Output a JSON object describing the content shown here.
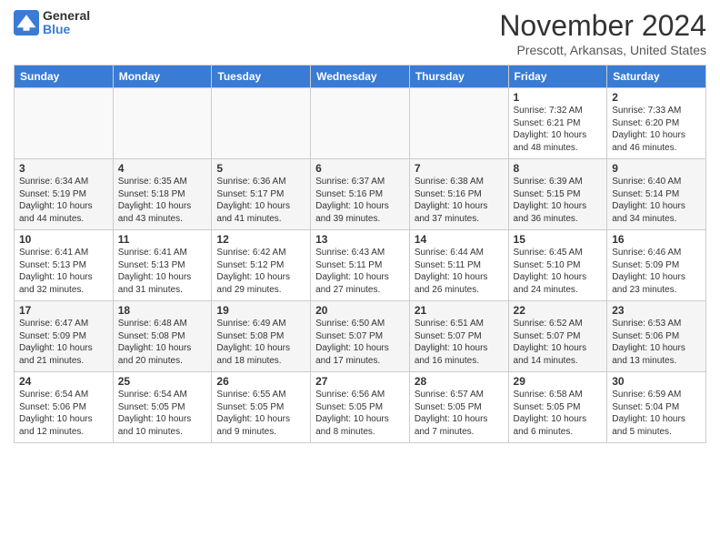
{
  "logo": {
    "general": "General",
    "blue": "Blue"
  },
  "header": {
    "month": "November 2024",
    "location": "Prescott, Arkansas, United States"
  },
  "weekdays": [
    "Sunday",
    "Monday",
    "Tuesday",
    "Wednesday",
    "Thursday",
    "Friday",
    "Saturday"
  ],
  "weeks": [
    [
      {
        "day": "",
        "info": ""
      },
      {
        "day": "",
        "info": ""
      },
      {
        "day": "",
        "info": ""
      },
      {
        "day": "",
        "info": ""
      },
      {
        "day": "",
        "info": ""
      },
      {
        "day": "1",
        "info": "Sunrise: 7:32 AM\nSunset: 6:21 PM\nDaylight: 10 hours\nand 48 minutes."
      },
      {
        "day": "2",
        "info": "Sunrise: 7:33 AM\nSunset: 6:20 PM\nDaylight: 10 hours\nand 46 minutes."
      }
    ],
    [
      {
        "day": "3",
        "info": "Sunrise: 6:34 AM\nSunset: 5:19 PM\nDaylight: 10 hours\nand 44 minutes."
      },
      {
        "day": "4",
        "info": "Sunrise: 6:35 AM\nSunset: 5:18 PM\nDaylight: 10 hours\nand 43 minutes."
      },
      {
        "day": "5",
        "info": "Sunrise: 6:36 AM\nSunset: 5:17 PM\nDaylight: 10 hours\nand 41 minutes."
      },
      {
        "day": "6",
        "info": "Sunrise: 6:37 AM\nSunset: 5:16 PM\nDaylight: 10 hours\nand 39 minutes."
      },
      {
        "day": "7",
        "info": "Sunrise: 6:38 AM\nSunset: 5:16 PM\nDaylight: 10 hours\nand 37 minutes."
      },
      {
        "day": "8",
        "info": "Sunrise: 6:39 AM\nSunset: 5:15 PM\nDaylight: 10 hours\nand 36 minutes."
      },
      {
        "day": "9",
        "info": "Sunrise: 6:40 AM\nSunset: 5:14 PM\nDaylight: 10 hours\nand 34 minutes."
      }
    ],
    [
      {
        "day": "10",
        "info": "Sunrise: 6:41 AM\nSunset: 5:13 PM\nDaylight: 10 hours\nand 32 minutes."
      },
      {
        "day": "11",
        "info": "Sunrise: 6:41 AM\nSunset: 5:13 PM\nDaylight: 10 hours\nand 31 minutes."
      },
      {
        "day": "12",
        "info": "Sunrise: 6:42 AM\nSunset: 5:12 PM\nDaylight: 10 hours\nand 29 minutes."
      },
      {
        "day": "13",
        "info": "Sunrise: 6:43 AM\nSunset: 5:11 PM\nDaylight: 10 hours\nand 27 minutes."
      },
      {
        "day": "14",
        "info": "Sunrise: 6:44 AM\nSunset: 5:11 PM\nDaylight: 10 hours\nand 26 minutes."
      },
      {
        "day": "15",
        "info": "Sunrise: 6:45 AM\nSunset: 5:10 PM\nDaylight: 10 hours\nand 24 minutes."
      },
      {
        "day": "16",
        "info": "Sunrise: 6:46 AM\nSunset: 5:09 PM\nDaylight: 10 hours\nand 23 minutes."
      }
    ],
    [
      {
        "day": "17",
        "info": "Sunrise: 6:47 AM\nSunset: 5:09 PM\nDaylight: 10 hours\nand 21 minutes."
      },
      {
        "day": "18",
        "info": "Sunrise: 6:48 AM\nSunset: 5:08 PM\nDaylight: 10 hours\nand 20 minutes."
      },
      {
        "day": "19",
        "info": "Sunrise: 6:49 AM\nSunset: 5:08 PM\nDaylight: 10 hours\nand 18 minutes."
      },
      {
        "day": "20",
        "info": "Sunrise: 6:50 AM\nSunset: 5:07 PM\nDaylight: 10 hours\nand 17 minutes."
      },
      {
        "day": "21",
        "info": "Sunrise: 6:51 AM\nSunset: 5:07 PM\nDaylight: 10 hours\nand 16 minutes."
      },
      {
        "day": "22",
        "info": "Sunrise: 6:52 AM\nSunset: 5:07 PM\nDaylight: 10 hours\nand 14 minutes."
      },
      {
        "day": "23",
        "info": "Sunrise: 6:53 AM\nSunset: 5:06 PM\nDaylight: 10 hours\nand 13 minutes."
      }
    ],
    [
      {
        "day": "24",
        "info": "Sunrise: 6:54 AM\nSunset: 5:06 PM\nDaylight: 10 hours\nand 12 minutes."
      },
      {
        "day": "25",
        "info": "Sunrise: 6:54 AM\nSunset: 5:05 PM\nDaylight: 10 hours\nand 10 minutes."
      },
      {
        "day": "26",
        "info": "Sunrise: 6:55 AM\nSunset: 5:05 PM\nDaylight: 10 hours\nand 9 minutes."
      },
      {
        "day": "27",
        "info": "Sunrise: 6:56 AM\nSunset: 5:05 PM\nDaylight: 10 hours\nand 8 minutes."
      },
      {
        "day": "28",
        "info": "Sunrise: 6:57 AM\nSunset: 5:05 PM\nDaylight: 10 hours\nand 7 minutes."
      },
      {
        "day": "29",
        "info": "Sunrise: 6:58 AM\nSunset: 5:05 PM\nDaylight: 10 hours\nand 6 minutes."
      },
      {
        "day": "30",
        "info": "Sunrise: 6:59 AM\nSunset: 5:04 PM\nDaylight: 10 hours\nand 5 minutes."
      }
    ]
  ]
}
